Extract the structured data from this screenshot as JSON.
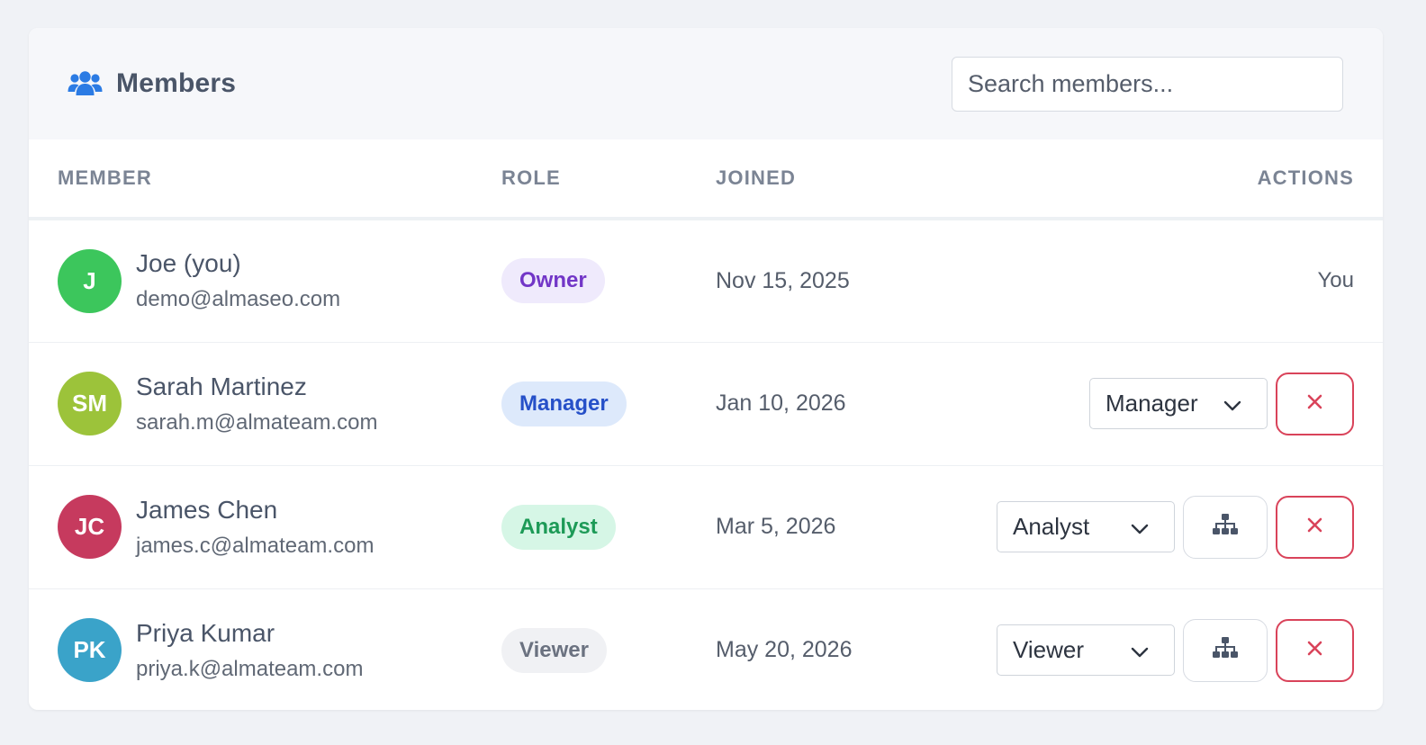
{
  "header": {
    "title": "Members",
    "search_placeholder": "Search members..."
  },
  "table": {
    "columns": {
      "member": "MEMBER",
      "role": "ROLE",
      "joined": "JOINED",
      "actions": "ACTIONS"
    },
    "rows": [
      {
        "initials": "J",
        "name": "Joe (you)",
        "email": "demo@almaseo.com",
        "role": "Owner",
        "joined": "Nov 15, 2025",
        "action_text": "You"
      },
      {
        "initials": "SM",
        "name": "Sarah Martinez",
        "email": "sarah.m@almateam.com",
        "role": "Manager",
        "joined": "Jan 10, 2026",
        "select_value": "Manager"
      },
      {
        "initials": "JC",
        "name": "James Chen",
        "email": "james.c@almateam.com",
        "role": "Analyst",
        "joined": "Mar 5, 2026",
        "select_value": "Analyst"
      },
      {
        "initials": "PK",
        "name": "Priya Kumar",
        "email": "priya.k@almateam.com",
        "role": "Viewer",
        "joined": "May 20, 2026",
        "select_value": "Viewer"
      }
    ]
  },
  "colors": {
    "accent": "#2b7be4",
    "avatar_joe": "#3cc65c",
    "avatar_sarah": "#9cc33a",
    "avatar_james": "#c63a5e",
    "avatar_priya": "#3aa3c9",
    "owner_badge_bg": "#efeafc",
    "owner_badge_text": "#7236c7",
    "manager_badge_bg": "#dde9fb",
    "manager_badge_text": "#2650c8",
    "analyst_badge_bg": "#d6f6e6",
    "analyst_badge_text": "#1d9a57",
    "viewer_badge_bg": "#f0f1f4",
    "viewer_badge_text": "#6b7280",
    "remove": "#d9435a"
  },
  "icons": {
    "title": "users-icon",
    "select": "chevron-down-icon",
    "hierarchy": "sitemap-icon",
    "remove": "close-icon"
  }
}
